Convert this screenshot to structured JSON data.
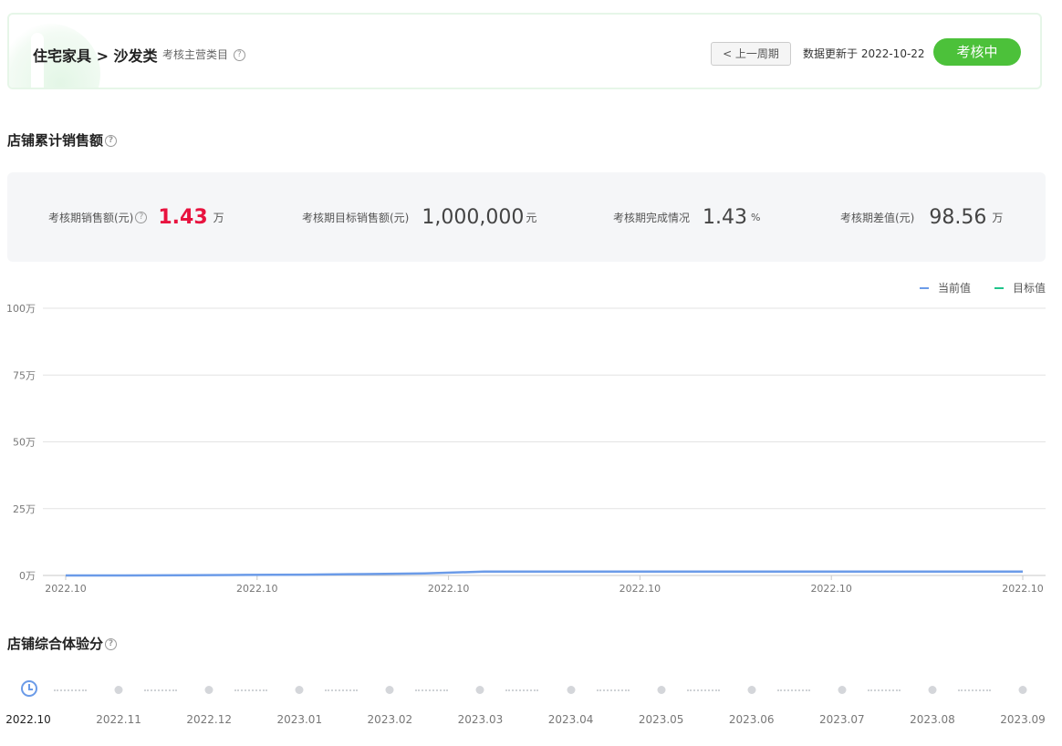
{
  "header": {
    "breadcrumb": "住宅家具 > 沙发类",
    "category_label": "考核主营类目",
    "prev_period_label": "< 上一周期",
    "updated_text": "数据更新于 2022-10-22",
    "status_label": "考核中",
    "status_color": "#4cc13a"
  },
  "sales_section": {
    "title": "店铺累计销售额",
    "stats": [
      {
        "label": "考核期销售额(元)",
        "value": "1.43",
        "unit": "万",
        "has_help": true
      },
      {
        "label": "考核期目标销售额(元)",
        "value": "1,000,000",
        "unit": "元",
        "has_help": false
      },
      {
        "label": "考核期完成情况",
        "value": "1.43",
        "unit": "%",
        "has_help": false
      },
      {
        "label": "考核期差值(元)",
        "value": "98.56",
        "unit": "万",
        "has_help": false
      }
    ]
  },
  "chart_data": {
    "type": "line",
    "x": [
      "2022.10",
      "2022.10",
      "2022.10",
      "2022.10",
      "2022.10",
      "2022.10"
    ],
    "y_ticks": [
      "0万",
      "25万",
      "50万",
      "75万",
      "100万"
    ],
    "ylim": [
      0,
      100
    ],
    "y_unit": "万",
    "grid": true,
    "legend_position": "top-right",
    "series": [
      {
        "name": "当前值",
        "color": "#6b9be8",
        "values": [
          0,
          0,
          0.1,
          0.2,
          0.3,
          0.5,
          0.8,
          1.43,
          1.43,
          1.43,
          1.43,
          1.43,
          1.43,
          1.43,
          1.43,
          1.43,
          1.43
        ]
      },
      {
        "name": "目标值",
        "color": "#1fc48a",
        "values": [
          100,
          100,
          100,
          100,
          100,
          100,
          100,
          100,
          100,
          100,
          100,
          100,
          100,
          100,
          100,
          100,
          100
        ]
      }
    ]
  },
  "score_section": {
    "title": "店铺综合体验分",
    "timeline": [
      "2022.10",
      "2022.11",
      "2022.12",
      "2023.01",
      "2023.02",
      "2023.03",
      "2023.04",
      "2023.05",
      "2023.06",
      "2023.07",
      "2023.08",
      "2023.09"
    ],
    "active_index": 0
  },
  "icons": {
    "help": "?",
    "clock": "clock-icon"
  }
}
